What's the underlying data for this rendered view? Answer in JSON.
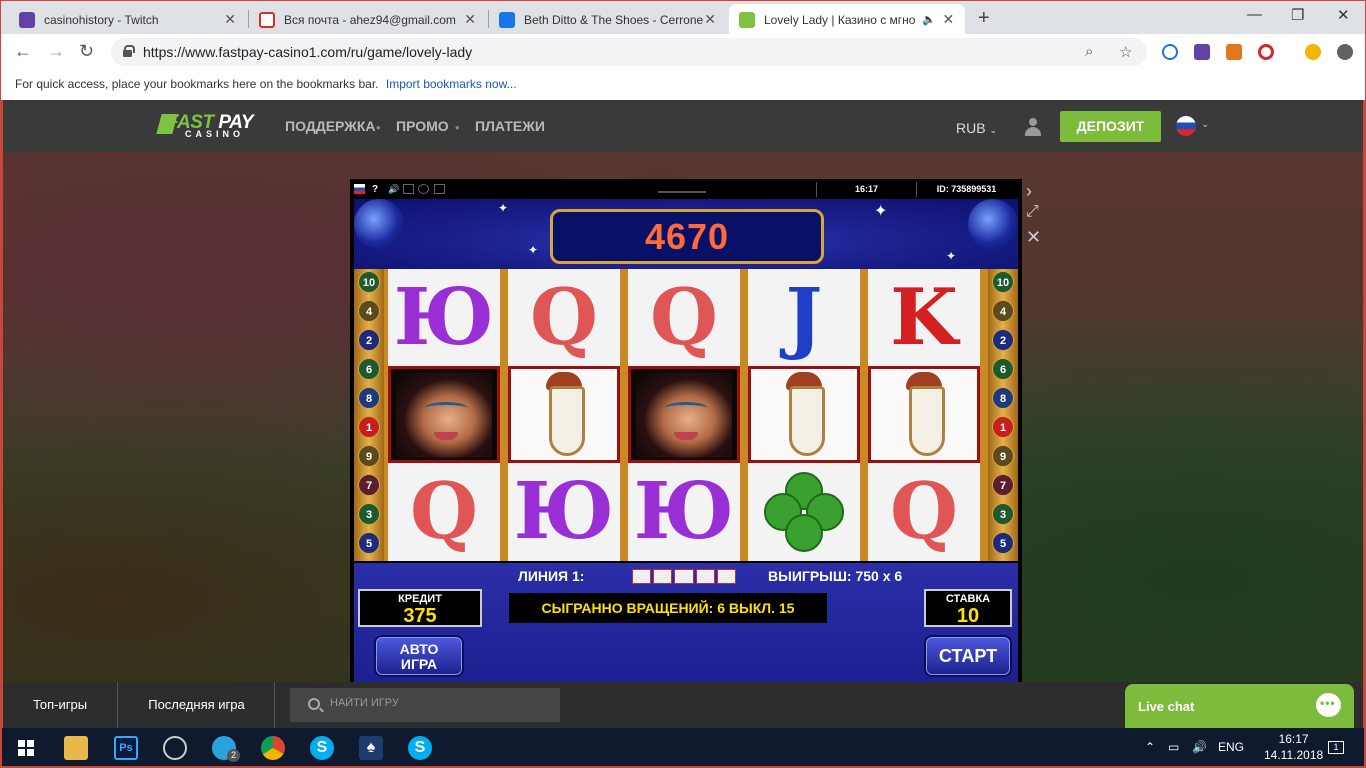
{
  "browser": {
    "tabs": [
      {
        "title": "casinohistory - Twitch",
        "icon_color": "#6441a5"
      },
      {
        "title": "Вся почта - ahez94@gmail.com",
        "icon_color": "#d93025"
      },
      {
        "title": "Beth Ditto & The Shoes - Cerrone",
        "icon_color": "#1a73e8"
      },
      {
        "title": "Lovely Lady | Казино с мгновенными выплатами",
        "icon_color": "#7ec242"
      }
    ],
    "url": "https://www.fastpay-casino1.com/ru/game/lovely-lady",
    "bookmarks_hint": "For quick access, place your bookmarks here on the bookmarks bar.",
    "import_bookmarks": "Import bookmarks now..."
  },
  "site": {
    "logo_fast": "FAST",
    "logo_pay": "PAY",
    "logo_casino": "CASINO",
    "nav": [
      "ПОДДЕРЖКА",
      "ПРОМО",
      "ПЛАТЕЖИ"
    ],
    "currency": "RUB",
    "deposit_label": "ДЕПОЗИТ",
    "accent_color": "#7dbb3c"
  },
  "game": {
    "time": "16:17",
    "session_id": "ID: 735899531",
    "score": "4670",
    "line_numbers_left": [
      "10",
      "4",
      "2",
      "6",
      "8",
      "1",
      "9",
      "7",
      "3",
      "5"
    ],
    "line_numbers_right": [
      "10",
      "4",
      "2",
      "6",
      "8",
      "1",
      "9",
      "7",
      "3",
      "5"
    ],
    "reels": [
      [
        "Ю",
        "lady",
        "Q"
      ],
      [
        "Q",
        "mushroom",
        "Ю"
      ],
      [
        "Q",
        "lady",
        "Ю"
      ],
      [
        "J",
        "mushroom",
        "clover"
      ],
      [
        "K",
        "mushroom",
        "Q"
      ]
    ],
    "line_label": "ЛИНИЯ 1:",
    "win_label": "ВЫИГРЫШ: 750 x 6",
    "credit_label": "КРЕДИТ",
    "credit_value": "375",
    "spins_text": "СЫГРАННО ВРАЩЕНИЙ: 6 ВЫКЛ. 15",
    "bet_label": "СТАВКА",
    "bet_value": "10",
    "auto_line1": "АВТО",
    "auto_line2": "ИГРА",
    "start_label": "СТАРТ"
  },
  "bottom": {
    "top_games": "Топ-игры",
    "last_game": "Последняя игра",
    "search_placeholder": "НАЙТИ ИГРУ",
    "live_chat": "Live chat"
  },
  "taskbar": {
    "language": "ENG",
    "time": "16:17",
    "date": "14.11.2018",
    "telegram_badge": "2",
    "notifications": "1"
  }
}
